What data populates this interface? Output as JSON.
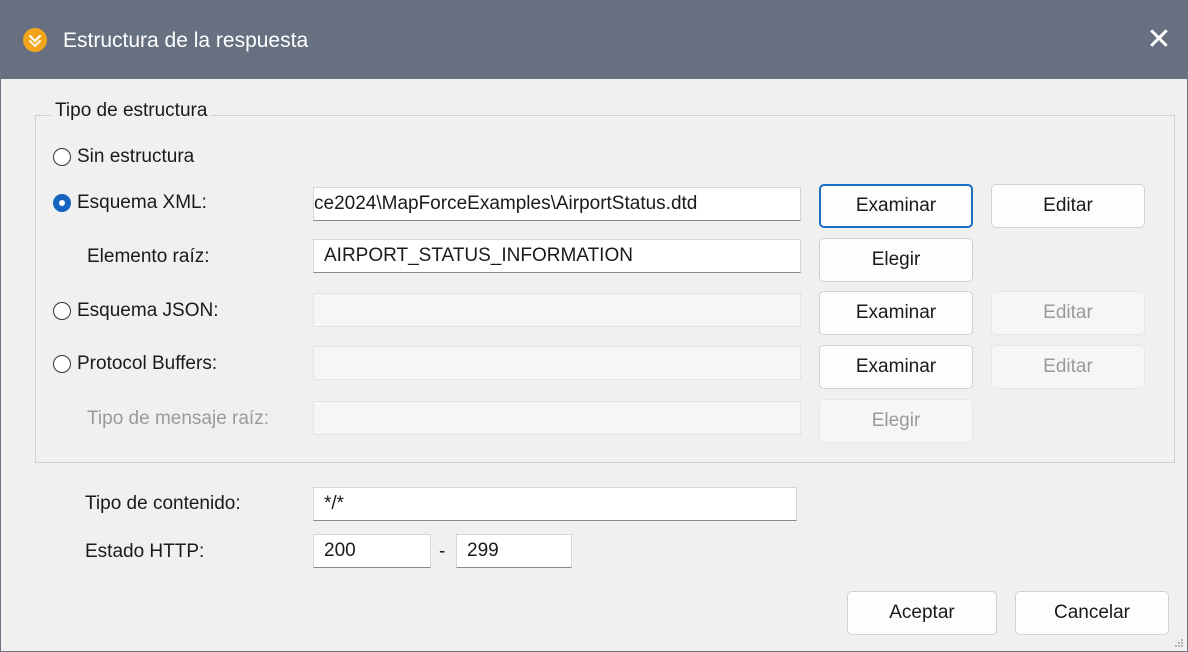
{
  "window": {
    "title": "Estructura de la respuesta",
    "close_glyph": "✕"
  },
  "structure_group": {
    "legend": "Tipo de estructura",
    "options": {
      "none": {
        "label": "Sin estructura",
        "selected": false
      },
      "xml": {
        "label": "Esquema XML:",
        "selected": true,
        "value": "ce2024\\MapForceExamples\\AirportStatus.dtd",
        "browse": "Examinar",
        "edit": "Editar"
      },
      "root_element": {
        "label": "Elemento raíz:",
        "value": "AIRPORT_STATUS_INFORMATION",
        "choose": "Elegir"
      },
      "json": {
        "label": "Esquema JSON:",
        "selected": false,
        "value": "",
        "browse": "Examinar",
        "edit": "Editar"
      },
      "protobuf": {
        "label": "Protocol Buffers:",
        "selected": false,
        "value": "",
        "browse": "Examinar",
        "edit": "Editar"
      },
      "root_message": {
        "label": "Tipo de mensaje raíz:",
        "value": "",
        "choose": "Elegir"
      }
    }
  },
  "content_type": {
    "label": "Tipo de contenido:",
    "value": "*/*"
  },
  "http_status": {
    "label": "Estado HTTP:",
    "from": "200",
    "separator": "-",
    "to": "299"
  },
  "footer": {
    "ok": "Aceptar",
    "cancel": "Cancelar"
  },
  "colors": {
    "titlebar": "#667080",
    "accent": "#1a6fc4",
    "app_icon": "#f2a41b"
  },
  "icons": {
    "app": "mapforce-app-icon",
    "close": "close-icon"
  }
}
